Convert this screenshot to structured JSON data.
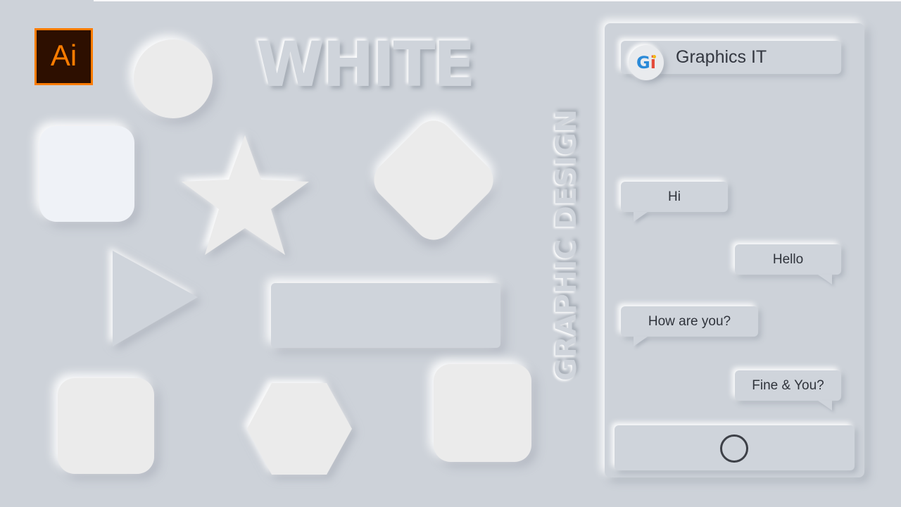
{
  "logo": {
    "text": "Ai",
    "icon": "adobe-illustrator-icon",
    "border_color": "#ff7c00",
    "bg_color": "#2d0f00"
  },
  "artwork": {
    "title": "WHITE",
    "vertical_text": "GRAPHIC DESIGN",
    "background_color": "#cdd2d9",
    "shape_color": "#ebebeb"
  },
  "chat": {
    "header": {
      "name": "Graphics IT",
      "avatar_letters": {
        "first": "G",
        "second": "i"
      }
    },
    "messages": [
      {
        "text": "Hi",
        "side": "left"
      },
      {
        "text": "Hello",
        "side": "right"
      },
      {
        "text": "How are you?",
        "side": "left"
      },
      {
        "text": "Fine & You?",
        "side": "right"
      }
    ]
  }
}
